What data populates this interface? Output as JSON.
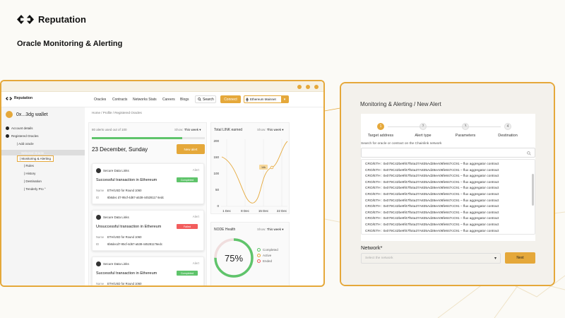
{
  "brand": {
    "name": "Reputation"
  },
  "headline": "Oracle Monitoring & Alerting",
  "colors": {
    "accent": "#e5a83a",
    "success": "#5fc46b",
    "danger": "#f25d5d",
    "ring_track": "#f0dede"
  },
  "app": {
    "logo_text": "Reputation",
    "nav": [
      "Oracles",
      "Contracts",
      "Networks Stats",
      "Careers",
      "Blogs"
    ],
    "search_label": "Search",
    "connect_label": "Connect",
    "network_label": "Ethereum Mainnet",
    "wallet": "0x...3dg wallet",
    "sidebar": {
      "account": "Account details",
      "registered": "Registered Oracles",
      "add": "| Add oracle",
      "selected": "Selected Oracle",
      "monitoring": "| Monitoring & Alerting",
      "rules": "| Rules",
      "history": "| History",
      "destination": "| Destination",
      "tenderly": "| Tenderly Pro °"
    },
    "breadcrumb": "Home / Profile / Registered Oracles",
    "alerts": {
      "count_text": "80 alerts used out of 100",
      "progress": 0.8,
      "show_label": "Show:",
      "show_value": "This week",
      "date": "23 December, Sunday",
      "new_alert": "New alert",
      "cards": [
        {
          "source": "Secure Data Links",
          "type": "Alert",
          "title": "Successful transaction in Ethereum",
          "status": "Completed",
          "status_color": "#5fc46b",
          "name_label": "Name",
          "name": "ETH/USD for Round 1060",
          "id_label": "ID",
          "id": "6b6dec d7-95cf-4d67-a538-44528117 6edc"
        },
        {
          "source": "Secure Data Links",
          "type": "Alert",
          "title": "Unsuccessful transaction in Ethereum",
          "status": "Failed",
          "status_color": "#f25d5d",
          "name_label": "Name",
          "name": "ETH/USD for Round 1060",
          "id_label": "ID",
          "id": "6b6decd7-95cf-4d67-a538-445281176edc"
        },
        {
          "source": "Secure Data Links",
          "type": "Alert",
          "title": "Successful transaction in Ethereum",
          "status": "Completed",
          "status_color": "#5fc46b",
          "name_label": "Name",
          "name": "ETH/USD for Round 1060",
          "id_label": "ID",
          "id": ""
        }
      ]
    },
    "link_chart": {
      "title": "Total LINK earned",
      "show_label": "Show:",
      "show_value": "This week",
      "y_ticks": [
        "200",
        "150",
        "100",
        "50",
        "0"
      ],
      "x_ticks": [
        "1 Dec",
        "8 Dec",
        "15 Dec",
        "22 Dec"
      ],
      "tooltip": "14k"
    },
    "node_health": {
      "title": "NODE Health",
      "show_label": "Show:",
      "show_value": "This week",
      "percent_text": "75%",
      "percent": 75,
      "legend": [
        {
          "label": "Completed",
          "color": "#5fc46b"
        },
        {
          "label": "Active",
          "color": "#e5a83a"
        },
        {
          "label": "Ended",
          "color": "#f25d5d"
        }
      ]
    }
  },
  "dialog": {
    "title": "Monitoring & Alerting / New Alert",
    "steps": [
      {
        "num": "1",
        "label": "Target address"
      },
      {
        "num": "2",
        "label": "Alert type"
      },
      {
        "num": "3",
        "label": "Parameters"
      },
      {
        "num": "4",
        "label": "Destination"
      }
    ],
    "search_label": "Search for oracle or contract on the Chainlink network",
    "search_value": "",
    "options": [
      "CRO/ETH : 0x079C42be9f47f54a37A835Ad28eA06fe847cC91 – flux aggregator contract",
      "CRO/ETH : 0x079C42be9f47f54a37A835Ad28eA06fe847cC91 – flux aggregator contract",
      "CRO/ETH : 0x079C42be9f47f54a37A835Ad28eA06fe847cC91 – flux aggregator contract",
      "CRO/ETH : 0x079C42be9f47f54a37A835Ad28eA06fe847cC91 – flux aggregator contract",
      "CRO/ETH : 0x079C42be9f47f54a37A835Ad28eA06fe847cC91 – flux aggregator contract",
      "CRO/ETH : 0x079C42be9f47f54a37A835Ad28eA06fe847cC91 – flux aggregator contract",
      "CRO/ETH : 0x079C42be9f47f54a37A835Ad28eA06fe847cC91 – flux aggregator contract",
      "CRO/ETH : 0x079C42be9f47f54a37A835Ad28eA06fe847cC91 – flux aggregator contract",
      "CRO/ETH : 0x079C42be9f47f54a37A835Ad28eA06fe847cC91 – flux aggregator contract",
      "CRO/ETH : 0x079C42be9f47f54a37A835Ad28eA06fe847cC91 – flux aggregator contract",
      "CRO/ETH : 0x079C42be9f47f54a37A835Ad28eA06fe847cC91 – flux aggregator contract",
      "CRO/ETH : 0x079C42be9f47f54a37A835Ad28eA06fe847cC91 – flux aggregator contract"
    ],
    "network_label": "Network*",
    "network_placeholder": "Select the network",
    "next_label": "Next"
  }
}
